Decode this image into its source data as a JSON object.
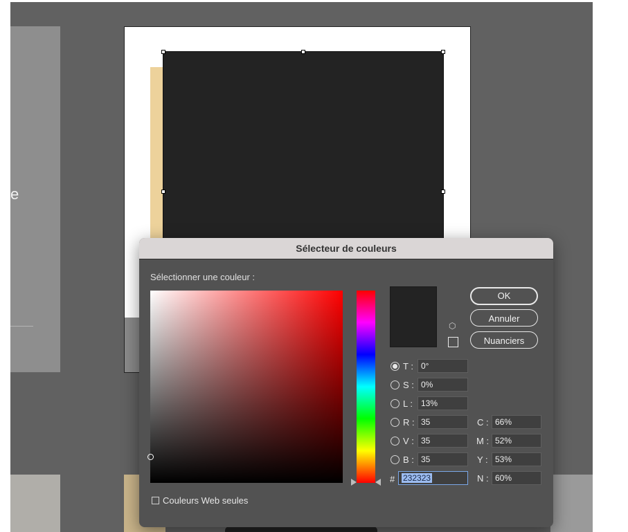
{
  "background": {
    "left_page_text": "e"
  },
  "dialog": {
    "title": "Sélecteur de couleurs",
    "prompt": "Sélectionner une couleur :",
    "buttons": {
      "ok": "OK",
      "cancel": "Annuler",
      "swatches": "Nuanciers"
    },
    "fields": {
      "T": {
        "label": "T :",
        "value": "0°",
        "selected": true
      },
      "S": {
        "label": "S :",
        "value": "0%"
      },
      "L": {
        "label": "L :",
        "value": "13%"
      },
      "R": {
        "label": "R :",
        "value": "35"
      },
      "V": {
        "label": "V :",
        "value": "35"
      },
      "B": {
        "label": "B :",
        "value": "35"
      },
      "C": {
        "label": "C :",
        "value": "66%"
      },
      "M": {
        "label": "M :",
        "value": "52%"
      },
      "Y": {
        "label": "Y :",
        "value": "53%"
      },
      "N": {
        "label": "N :",
        "value": "60%"
      },
      "hex": {
        "label": "#",
        "value": "232323"
      }
    },
    "web_only_label": "Couleurs Web seules",
    "current_color": "#232323"
  },
  "colors": {
    "workspace": "#616161",
    "dialog_bg": "#525252",
    "selected_fill": "#232323",
    "accent_selection": "#9cbcf0"
  }
}
